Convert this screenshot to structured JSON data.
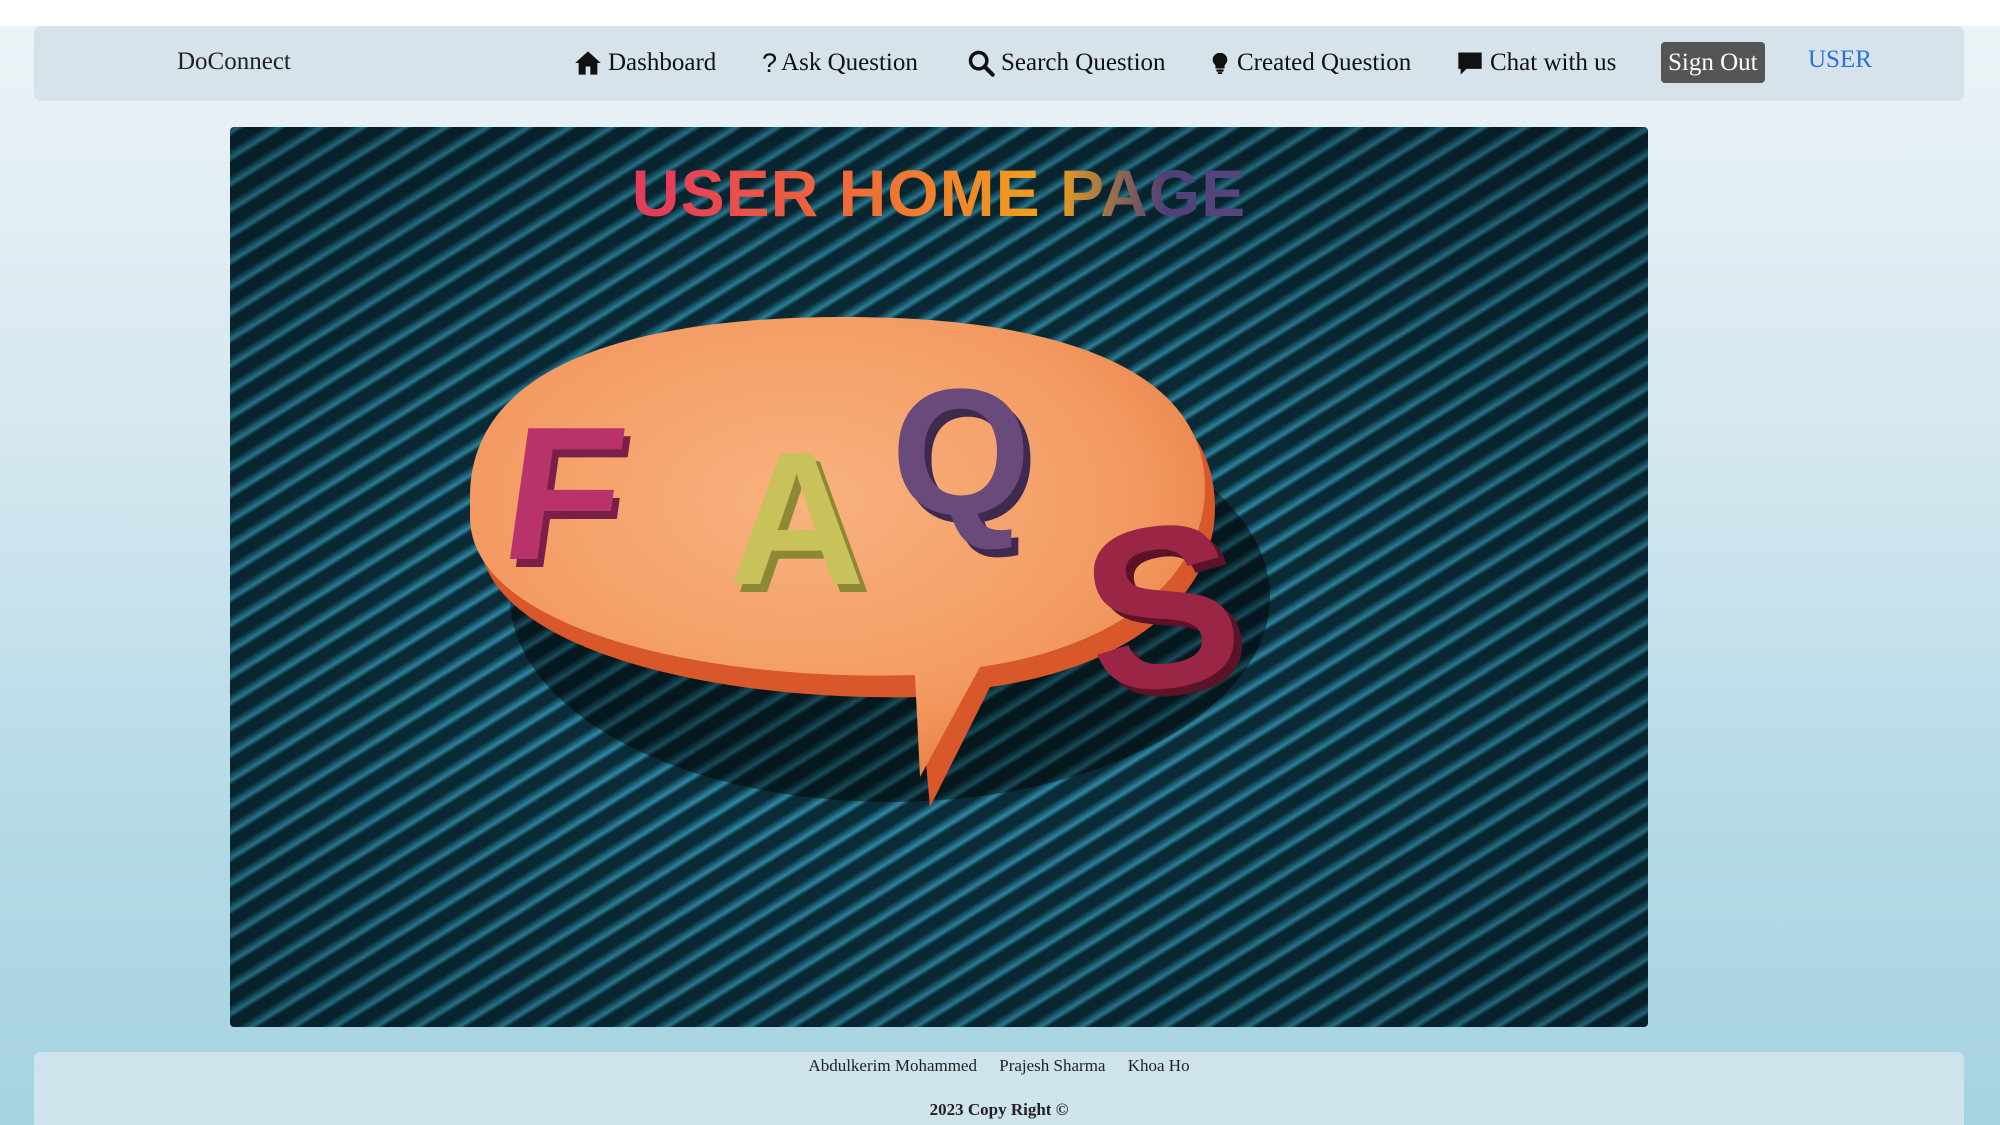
{
  "app": {
    "brand": "DoConnect"
  },
  "nav": {
    "dashboard": "Dashboard",
    "ask_question": "Ask Question",
    "search_question": "Search Question",
    "created_question": "Created Question",
    "chat": "Chat with us",
    "sign_out": "Sign Out",
    "user": "USER"
  },
  "hero": {
    "title": "USER HOME PAGE",
    "letters": [
      "F",
      "A",
      "Q",
      "S"
    ]
  },
  "footer": {
    "authors": [
      "Abdulkerim Mohammed",
      "Prajesh Sharma",
      "Khoa Ho"
    ],
    "copyright": "2023 Copy Right ©"
  },
  "colors": {
    "navbar_bg": "#d6e3ea",
    "sign_out_bg": "#555555",
    "user_link": "#2a73d8",
    "bubble": "#f4a06a",
    "letter_f": "#b8336a",
    "letter_a": "#c9c25a",
    "letter_q": "#6a4a7a",
    "letter_s": "#9a2544"
  },
  "icons": {
    "dashboard": "home-icon",
    "ask_question": "question-mark-icon",
    "search_question": "search-icon",
    "created_question": "lightbulb-icon",
    "chat": "chat-bubble-icon"
  }
}
